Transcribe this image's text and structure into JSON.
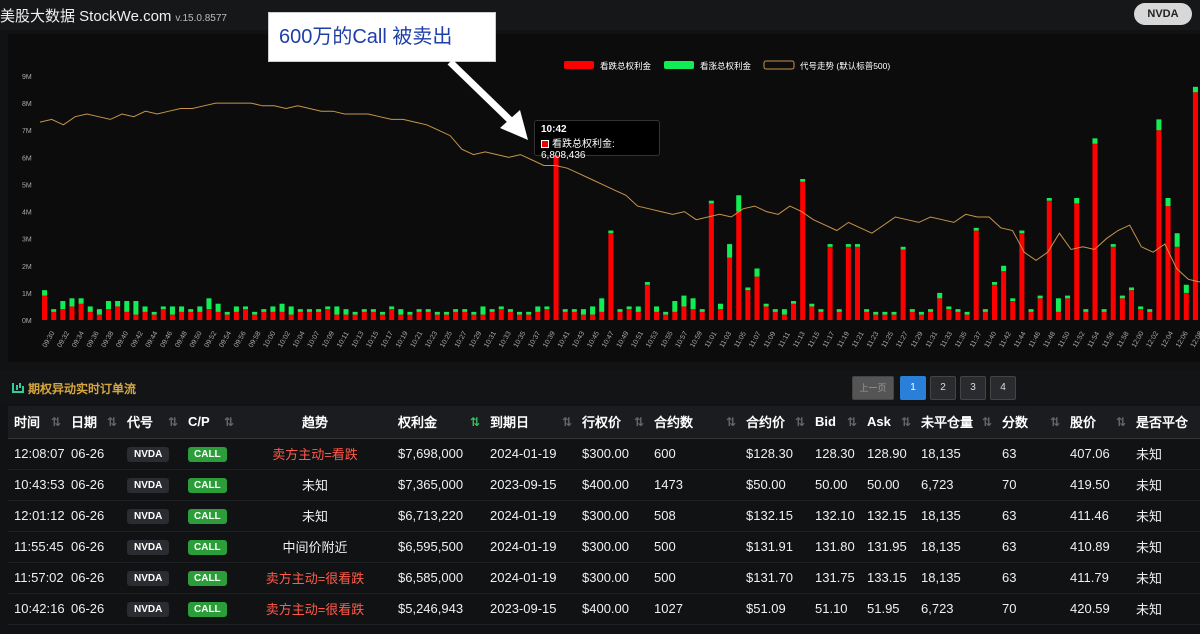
{
  "app": {
    "title": "美股大数据 StockWe.com",
    "version": "v.15.0.8577",
    "ticker_button": "NVDA"
  },
  "annotation": {
    "text": "600万的Call 被卖出"
  },
  "tooltip": {
    "time": "10:42",
    "label": "看跌总权利金: 6,808,436"
  },
  "colors": {
    "put": "#ff0000",
    "call": "#11ee55",
    "line": "#c8954a",
    "accent": "#d4a640"
  },
  "chart_data": {
    "type": "bar",
    "legend": [
      "看跌总权利金",
      "看涨总权利金",
      "代号走势 (默认标普500)"
    ],
    "legend_position": "top-right",
    "y_ticks": [
      "0M",
      "1M",
      "2M",
      "3M",
      "4M",
      "5M",
      "6M",
      "7M",
      "8M",
      "9M"
    ],
    "ylim": [
      0,
      9
    ],
    "x_tick_labels": [
      "09:30",
      "09:32",
      "09:34",
      "09:36",
      "09:38",
      "09:40",
      "09:42",
      "09:44",
      "09:46",
      "09:48",
      "09:50",
      "09:52",
      "09:54",
      "09:56",
      "09:58",
      "10:00",
      "10:02",
      "10:04",
      "10:07",
      "10:09",
      "10:11",
      "10:13",
      "10:15",
      "10:17",
      "10:19",
      "10:21",
      "10:23",
      "10:25",
      "10:27",
      "10:29",
      "10:31",
      "10:33",
      "10:35",
      "10:37",
      "10:39",
      "10:41",
      "10:43",
      "10:45",
      "10:47",
      "10:49",
      "10:51",
      "10:53",
      "10:55",
      "10:57",
      "10:59",
      "11:01",
      "11:03",
      "11:05",
      "11:07",
      "11:09",
      "11:11",
      "11:13",
      "11:15",
      "11:17",
      "11:19",
      "11:21",
      "11:23",
      "11:25",
      "11:27",
      "11:29",
      "11:31",
      "11:33",
      "11:35",
      "11:37",
      "11:40",
      "11:42",
      "11:44",
      "11:46",
      "11:48",
      "11:50",
      "11:52",
      "11:54",
      "11:56",
      "11:58",
      "12:00",
      "12:02",
      "12:04",
      "12:06",
      "12:08"
    ],
    "series": [
      {
        "name": "看跌总权利金",
        "values": [
          0.9,
          0.3,
          0.4,
          0.5,
          0.6,
          0.3,
          0.2,
          0.4,
          0.5,
          0.3,
          0.2,
          0.3,
          0.2,
          0.4,
          0.2,
          0.3,
          0.3,
          0.3,
          0.4,
          0.3,
          0.2,
          0.3,
          0.4,
          0.2,
          0.3,
          0.3,
          0.3,
          0.2,
          0.3,
          0.3,
          0.3,
          0.4,
          0.2,
          0.2,
          0.2,
          0.3,
          0.3,
          0.2,
          0.4,
          0.2,
          0.2,
          0.3,
          0.3,
          0.2,
          0.2,
          0.3,
          0.3,
          0.2,
          0.2,
          0.3,
          0.4,
          0.3,
          0.2,
          0.2,
          0.3,
          0.4,
          6.8,
          0.3,
          0.3,
          0.2,
          0.2,
          0.3,
          3.2,
          0.3,
          0.4,
          0.3,
          1.3,
          0.3,
          0.2,
          0.3,
          0.5,
          0.4,
          0.3,
          4.3,
          0.4,
          2.3,
          4.0,
          1.1,
          1.6,
          0.5,
          0.3,
          0.2,
          0.6,
          5.1,
          0.5,
          0.3,
          2.7,
          0.3,
          2.7,
          2.7,
          0.3,
          0.2,
          0.2,
          0.2,
          2.6,
          0.3,
          0.2,
          0.3,
          0.8,
          0.4,
          0.3,
          0.2,
          3.3,
          0.3,
          1.3,
          1.8,
          0.7,
          3.2,
          0.3,
          0.8,
          4.4,
          0.3,
          0.8,
          4.3,
          0.3,
          6.5,
          0.3,
          2.7,
          0.8,
          1.1,
          0.4,
          0.3,
          7.0,
          4.2,
          2.7,
          1.0,
          8.4
        ]
      },
      {
        "name": "看涨总权利金",
        "values": [
          0.2,
          0.1,
          0.3,
          0.3,
          0.2,
          0.2,
          0.2,
          0.3,
          0.2,
          0.4,
          0.5,
          0.2,
          0.1,
          0.1,
          0.3,
          0.2,
          0.1,
          0.2,
          0.4,
          0.3,
          0.1,
          0.2,
          0.1,
          0.1,
          0.1,
          0.2,
          0.3,
          0.3,
          0.1,
          0.1,
          0.1,
          0.1,
          0.3,
          0.2,
          0.1,
          0.1,
          0.1,
          0.1,
          0.1,
          0.2,
          0.1,
          0.1,
          0.1,
          0.1,
          0.1,
          0.1,
          0.1,
          0.1,
          0.3,
          0.1,
          0.1,
          0.1,
          0.1,
          0.1,
          0.2,
          0.1,
          0.1,
          0.1,
          0.1,
          0.2,
          0.3,
          0.5,
          0.1,
          0.1,
          0.1,
          0.2,
          0.1,
          0.2,
          0.1,
          0.4,
          0.4,
          0.4,
          0.1,
          0.1,
          0.2,
          0.5,
          0.6,
          0.1,
          0.3,
          0.1,
          0.1,
          0.2,
          0.1,
          0.1,
          0.1,
          0.1,
          0.1,
          0.1,
          0.1,
          0.1,
          0.1,
          0.1,
          0.1,
          0.1,
          0.1,
          0.1,
          0.1,
          0.1,
          0.2,
          0.1,
          0.1,
          0.1,
          0.1,
          0.1,
          0.1,
          0.2,
          0.1,
          0.1,
          0.1,
          0.1,
          0.1,
          0.5,
          0.1,
          0.2,
          0.1,
          0.2,
          0.1,
          0.1,
          0.1,
          0.1,
          0.1,
          0.1,
          0.4,
          0.3,
          0.5,
          0.3,
          0.2
        ]
      },
      {
        "name": "代号走势 (默认标普500)",
        "values": [
          7.3,
          7.4,
          7.2,
          7.5,
          7.6,
          7.5,
          7.4,
          7.6,
          7.5,
          7.7,
          7.6,
          7.7,
          7.8,
          7.8,
          7.9,
          8.0,
          8.0,
          8.0,
          8.0,
          7.9,
          7.9,
          7.8,
          7.9,
          7.8,
          7.7,
          7.7,
          7.6,
          7.6,
          7.6,
          7.5,
          7.4,
          7.4,
          7.3,
          7.2,
          7.0,
          6.8,
          6.3,
          6.1,
          6.2,
          6.1,
          6.0,
          6.1,
          5.9,
          5.7,
          5.7,
          5.6,
          5.4,
          5.2,
          5.0,
          4.8,
          4.6,
          4.2,
          4.1,
          4.0,
          3.9,
          4.0,
          3.7,
          3.8,
          3.9,
          3.8,
          4.1,
          4.2,
          4.0,
          3.9,
          4.2,
          4.0,
          3.7,
          3.5,
          3.3,
          3.6,
          3.4,
          3.2,
          3.5,
          3.8,
          3.7,
          3.6,
          3.8,
          3.7,
          3.6,
          3.9,
          3.8,
          3.8,
          3.4,
          3.3,
          2.5,
          2.2,
          2.5,
          3.2,
          2.6,
          2.7,
          2.6,
          3.0,
          3.3,
          3.5,
          2.7,
          2.5,
          2.8,
          1.9,
          1.5,
          1.4
        ]
      }
    ]
  },
  "section": {
    "title": "期权异动实时订单流"
  },
  "pager": {
    "prev": "上一页",
    "pages": [
      "1",
      "2",
      "3",
      "4"
    ]
  },
  "table": {
    "headers": [
      "时间",
      "日期",
      "代号",
      "C/P",
      "趋势",
      "权利金",
      "到期日",
      "行权价",
      "合约数",
      "合约价",
      "Bid",
      "Ask",
      "未平仓量",
      "分数",
      "股价",
      "是否平仓"
    ],
    "rows": [
      [
        "12:08:07",
        "06-26",
        "NVDA",
        "CALL",
        "卖方主动=看跌",
        "$7,698,000",
        "2024-01-19",
        "$300.00",
        "600",
        "$128.30",
        "128.30",
        "128.90",
        "18,135",
        "63",
        "407.06",
        "未知"
      ],
      [
        "10:43:53",
        "06-26",
        "NVDA",
        "CALL",
        "未知",
        "$7,365,000",
        "2023-09-15",
        "$400.00",
        "1473",
        "$50.00",
        "50.00",
        "50.00",
        "6,723",
        "70",
        "419.50",
        "未知"
      ],
      [
        "12:01:12",
        "06-26",
        "NVDA",
        "CALL",
        "未知",
        "$6,713,220",
        "2024-01-19",
        "$300.00",
        "508",
        "$132.15",
        "132.10",
        "132.15",
        "18,135",
        "63",
        "411.46",
        "未知"
      ],
      [
        "11:55:45",
        "06-26",
        "NVDA",
        "CALL",
        "中间价附近",
        "$6,595,500",
        "2024-01-19",
        "$300.00",
        "500",
        "$131.91",
        "131.80",
        "131.95",
        "18,135",
        "63",
        "410.89",
        "未知"
      ],
      [
        "11:57:02",
        "06-26",
        "NVDA",
        "CALL",
        "卖方主动=很看跌",
        "$6,585,000",
        "2024-01-19",
        "$300.00",
        "500",
        "$131.70",
        "131.75",
        "133.15",
        "18,135",
        "63",
        "411.79",
        "未知"
      ],
      [
        "10:42:16",
        "06-26",
        "NVDA",
        "CALL",
        "卖方主动=很看跌",
        "$5,246,943",
        "2023-09-15",
        "$400.00",
        "1027",
        "$51.09",
        "51.10",
        "51.95",
        "6,723",
        "70",
        "420.59",
        "未知"
      ]
    ]
  }
}
